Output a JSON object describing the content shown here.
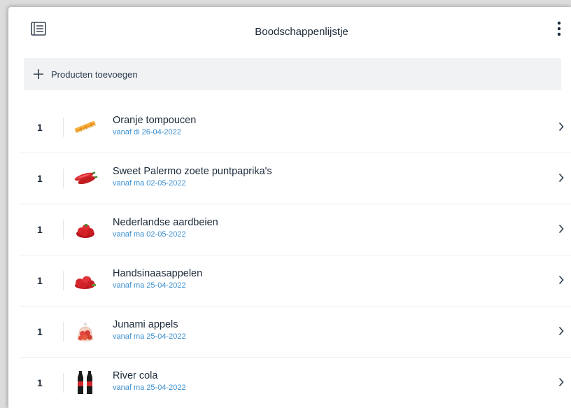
{
  "header": {
    "title": "Boodschappenlijstje",
    "left_icon": "list-icon",
    "right_icon": "more-vertical-icon"
  },
  "add_bar": {
    "icon": "plus-icon",
    "label": "Producten toevoegen"
  },
  "items": [
    {
      "qty": "1",
      "name": "Oranje tompoucen",
      "sub": "vanaf di 26-04-2022",
      "thumb": "tompoucen"
    },
    {
      "qty": "1",
      "name": "Sweet Palermo zoete puntpaprika's",
      "sub": "vanaf ma 02-05-2022",
      "thumb": "paprika"
    },
    {
      "qty": "1",
      "name": "Nederlandse aardbeien",
      "sub": "vanaf ma 02-05-2022",
      "thumb": "aardbeien"
    },
    {
      "qty": "1",
      "name": "Handsinaasappelen",
      "sub": "vanaf ma 25-04-2022",
      "thumb": "sinaasappelen"
    },
    {
      "qty": "1",
      "name": "Junami appels",
      "sub": "vanaf ma 25-04-2022",
      "thumb": "appels"
    },
    {
      "qty": "1",
      "name": "River cola",
      "sub": "vanaf ma 25-04-2022",
      "thumb": "cola"
    }
  ],
  "colors": {
    "accent_blue": "#3a8fd1",
    "text_dark": "#1b2a3a",
    "add_bar_bg": "#f0f2f4"
  }
}
